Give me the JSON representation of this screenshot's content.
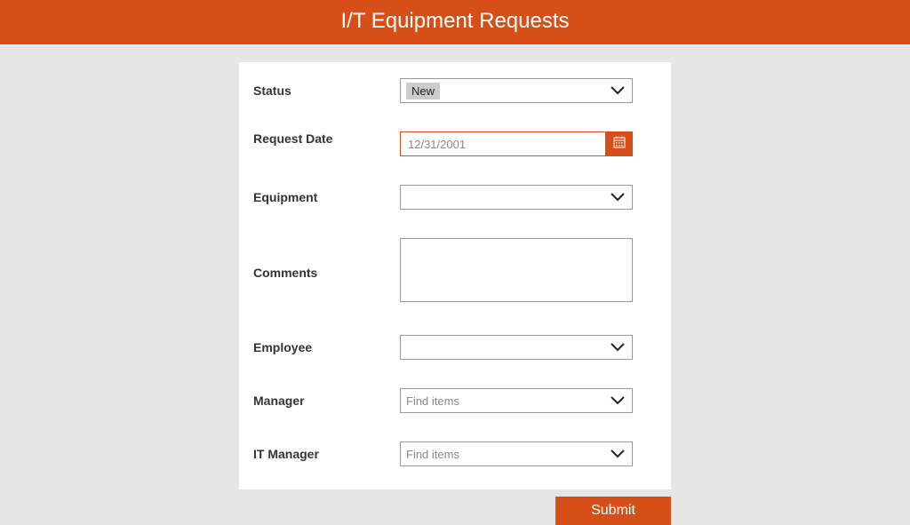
{
  "header": {
    "title": "I/T Equipment Requests"
  },
  "form": {
    "status": {
      "label": "Status",
      "value": "New"
    },
    "request_date": {
      "label": "Request Date",
      "placeholder": "12/31/2001"
    },
    "equipment": {
      "label": "Equipment",
      "value": ""
    },
    "comments": {
      "label": "Comments",
      "value": ""
    },
    "employee": {
      "label": "Employee",
      "value": ""
    },
    "manager": {
      "label": "Manager",
      "placeholder": "Find items"
    },
    "it_manager": {
      "label": "IT Manager",
      "placeholder": "Find items"
    }
  },
  "submit_label": "Submit",
  "colors": {
    "accent": "#d64f18"
  }
}
